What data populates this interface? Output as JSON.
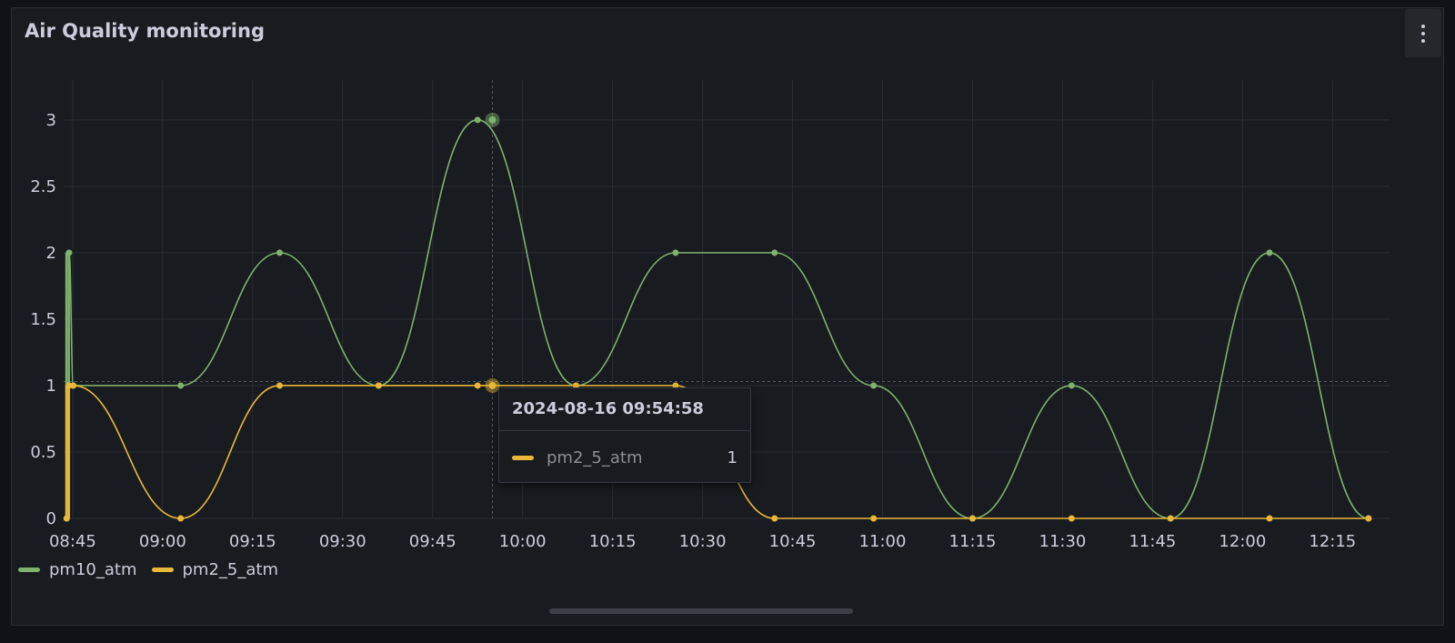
{
  "panel": {
    "title": "Air Quality monitoring",
    "menu_icon": "kebab-menu-icon"
  },
  "colors": {
    "pm10": "#7eb26d",
    "pm2_5": "#eab839",
    "background": "#181b1f",
    "grid": "#2a2d33"
  },
  "tooltip": {
    "time": "2024-08-16 09:54:58",
    "series": "pm2_5_atm",
    "value": "1"
  },
  "chart_data": {
    "type": "line",
    "title": "Air Quality monitoring",
    "xlabel": "",
    "ylabel": "",
    "x_ticks": [
      "08:45",
      "09:00",
      "09:15",
      "09:30",
      "09:45",
      "10:00",
      "10:15",
      "10:30",
      "10:45",
      "11:00",
      "11:15",
      "11:30",
      "11:45",
      "12:00",
      "12:15"
    ],
    "x_tick_minutes": [
      525,
      540,
      555,
      570,
      585,
      600,
      615,
      630,
      645,
      660,
      675,
      690,
      705,
      720,
      735
    ],
    "xlim_minutes": [
      523.5,
      744.5
    ],
    "y_ticks": [
      "0",
      "0.5",
      "1",
      "1.5",
      "2",
      "2.5",
      "3"
    ],
    "ylim": [
      0,
      3.3
    ],
    "grid": true,
    "legend": "bottom-left",
    "series": [
      {
        "name": "pm10_atm",
        "x": [
          524.4,
          525.1,
          543.0,
          559.5,
          576.0,
          592.5,
          608.9,
          625.5,
          642.0,
          658.5,
          675.0,
          691.5,
          708.0,
          724.5,
          741.0
        ],
        "values": [
          2,
          1,
          1,
          2,
          1,
          3,
          1,
          2,
          2,
          1,
          0,
          1,
          0,
          2,
          0
        ],
        "jump_from": [
          [
            524.0,
            0
          ],
          [
            524.4,
            0
          ]
        ]
      },
      {
        "name": "pm2_5_atm",
        "x": [
          524.4,
          525.1,
          543.0,
          559.5,
          576.0,
          592.5,
          608.9,
          625.5,
          642.0,
          658.5,
          675.0,
          691.5,
          708.0,
          724.5,
          741.0
        ],
        "values": [
          1,
          1,
          0,
          1,
          1,
          1,
          1,
          1,
          0,
          0,
          0,
          0,
          0,
          0,
          0
        ],
        "jump_from": [
          [
            524.0,
            0
          ],
          [
            524.4,
            0
          ]
        ]
      }
    ],
    "hover_time": "09:54:58",
    "hover_minutes": 594.97
  }
}
